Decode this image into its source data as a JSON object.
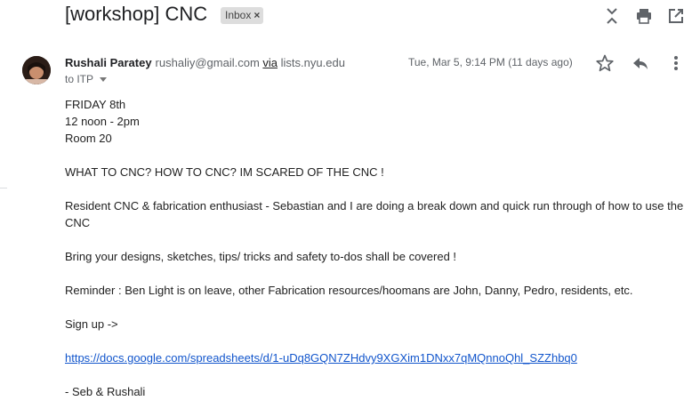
{
  "email": {
    "subject": "[workshop] CNC",
    "label": "Inbox",
    "label_close": "×",
    "sender_name": "Rushali Paratey",
    "sender_email": "rushaliy@gmail.com",
    "via_label": "via",
    "via_list": "lists.nyu.edu",
    "recipients": "to ITP",
    "date": "Tue, Mar 5, 9:14 PM (11 days ago)",
    "body": {
      "line1": "FRIDAY 8th",
      "line2": "12 noon - 2pm",
      "line3": "Room 20",
      "line4": "WHAT TO CNC? HOW TO CNC? IM SCARED OF THE CNC !",
      "line5": "Resident CNC & fabrication enthusiast - Sebastian and I are doing a break down and quick run through of how to use the CNC",
      "line6": "Bring your designs, sketches, tips/ tricks and safety to-dos shall be covered !",
      "line7": "Reminder : Ben Light is on leave, other Fabrication resources/hoomans are John, Danny, Pedro, residents, etc.",
      "line8": "Sign up ->",
      "link": "https://docs.google.com/spreadsheets/d/1-uDq8GQN7ZHdvy9XGXim1DNxx7qMQnnoQhl_SZZhbq0",
      "signature": "- Seb & Rushali"
    }
  },
  "icons": {
    "collapse": "collapse-all-icon",
    "print": "print-icon",
    "popout": "open-new-window-icon",
    "star": "star-icon",
    "reply": "reply-icon",
    "more": "more-vert-icon"
  },
  "colors": {
    "link": "#1155cc",
    "label_bg": "#dddddd",
    "icon": "#5f6368"
  }
}
